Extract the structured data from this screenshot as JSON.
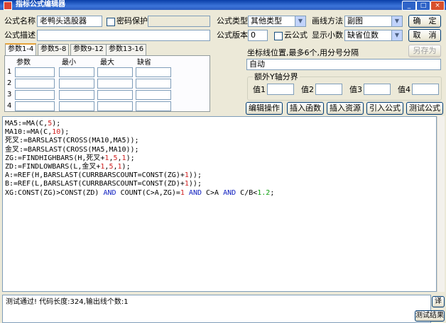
{
  "window": {
    "title": "指标公式编辑器",
    "minimize": "_",
    "maximize": "□",
    "close": "×"
  },
  "form": {
    "name_label": "公式名称",
    "name_value": "老鸭头选股器",
    "password_label": "密码保护",
    "type_label": "公式类型",
    "type_value": "其他类型",
    "draw_label": "画线方法",
    "draw_value": "副图",
    "confirm_button": "确　定",
    "cancel_button": "取　消",
    "desc_label": "公式描述",
    "desc_value": "",
    "version_label": "公式版本",
    "version_value": "0",
    "cloud_label": "云公式",
    "decimals_label": "显示小数",
    "decimals_value": "缺省位数",
    "saveas_button": "另存为"
  },
  "tabs": [
    "参数1-4",
    "参数5-8",
    "参数9-12",
    "参数13-16"
  ],
  "params": {
    "headers": [
      "参数",
      "最小",
      "最大",
      "缺省"
    ],
    "rows": [
      "1",
      "2",
      "3",
      "4"
    ]
  },
  "axis": {
    "label": "坐标线位置,最多6个,用分号分隔",
    "value": "自动"
  },
  "extra_axis": {
    "title": "额外Y轴分界",
    "labels": [
      "值1",
      "值2",
      "值3",
      "值4"
    ]
  },
  "toolbar": [
    "编辑操作",
    "插入函数",
    "插入资源",
    "引入公式",
    "测试公式"
  ],
  "code": [
    [
      {
        "t": "MA5:=MA(C,",
        "c": ""
      },
      {
        "t": "5",
        "c": "red"
      },
      {
        "t": ");",
        "c": ""
      }
    ],
    [
      {
        "t": "MA10:=MA(C,",
        "c": ""
      },
      {
        "t": "10",
        "c": "red"
      },
      {
        "t": ");",
        "c": ""
      }
    ],
    [
      {
        "t": "死叉:=BARSLAST(CROSS(MA10,MA5));",
        "c": ""
      }
    ],
    [
      {
        "t": "金叉:=BARSLAST(CROSS(MA5,MA10));",
        "c": ""
      }
    ],
    [
      {
        "t": "ZG:=FINDHIGHBARS(H,死叉+",
        "c": ""
      },
      {
        "t": "1",
        "c": "red"
      },
      {
        "t": ",",
        "c": ""
      },
      {
        "t": "5",
        "c": "red"
      },
      {
        "t": ",",
        "c": ""
      },
      {
        "t": "1",
        "c": "red"
      },
      {
        "t": ");",
        "c": ""
      }
    ],
    [
      {
        "t": "ZD:=FINDLOWBARS(L,金叉+",
        "c": ""
      },
      {
        "t": "1",
        "c": "red"
      },
      {
        "t": ",",
        "c": ""
      },
      {
        "t": "5",
        "c": "red"
      },
      {
        "t": ",",
        "c": ""
      },
      {
        "t": "1",
        "c": "red"
      },
      {
        "t": ");",
        "c": ""
      }
    ],
    [
      {
        "t": "A:=REF(H,BARSLAST(CURRBARSCOUNT=CONST(ZG)+",
        "c": ""
      },
      {
        "t": "1",
        "c": "red"
      },
      {
        "t": "));",
        "c": ""
      }
    ],
    [
      {
        "t": "B:=REF(L,BARSLAST(CURRBARSCOUNT=CONST(ZD)+",
        "c": ""
      },
      {
        "t": "1",
        "c": "red"
      },
      {
        "t": "));",
        "c": ""
      }
    ],
    [
      {
        "t": "XG:CONST(ZG)>CONST(ZD) ",
        "c": ""
      },
      {
        "t": "AND",
        "c": "blue"
      },
      {
        "t": " COUNT(C>A,ZG)=",
        "c": ""
      },
      {
        "t": "1",
        "c": "red"
      },
      {
        "t": " ",
        "c": ""
      },
      {
        "t": "AND",
        "c": "blue"
      },
      {
        "t": " C>A ",
        "c": ""
      },
      {
        "t": "AND",
        "c": "blue"
      },
      {
        "t": " C/B<",
        "c": ""
      },
      {
        "t": "1.2",
        "c": "green"
      },
      {
        "t": ";",
        "c": ""
      }
    ]
  ],
  "status": {
    "message": "测试通过! 代码长度:324,输出线个数:1",
    "side_tab": "译",
    "result_tab": "测试结果"
  },
  "colors": {
    "keyword": "#1020c0",
    "number": "#d02020",
    "decimal": "#10a010",
    "titlebar": "#0a3fa8"
  }
}
